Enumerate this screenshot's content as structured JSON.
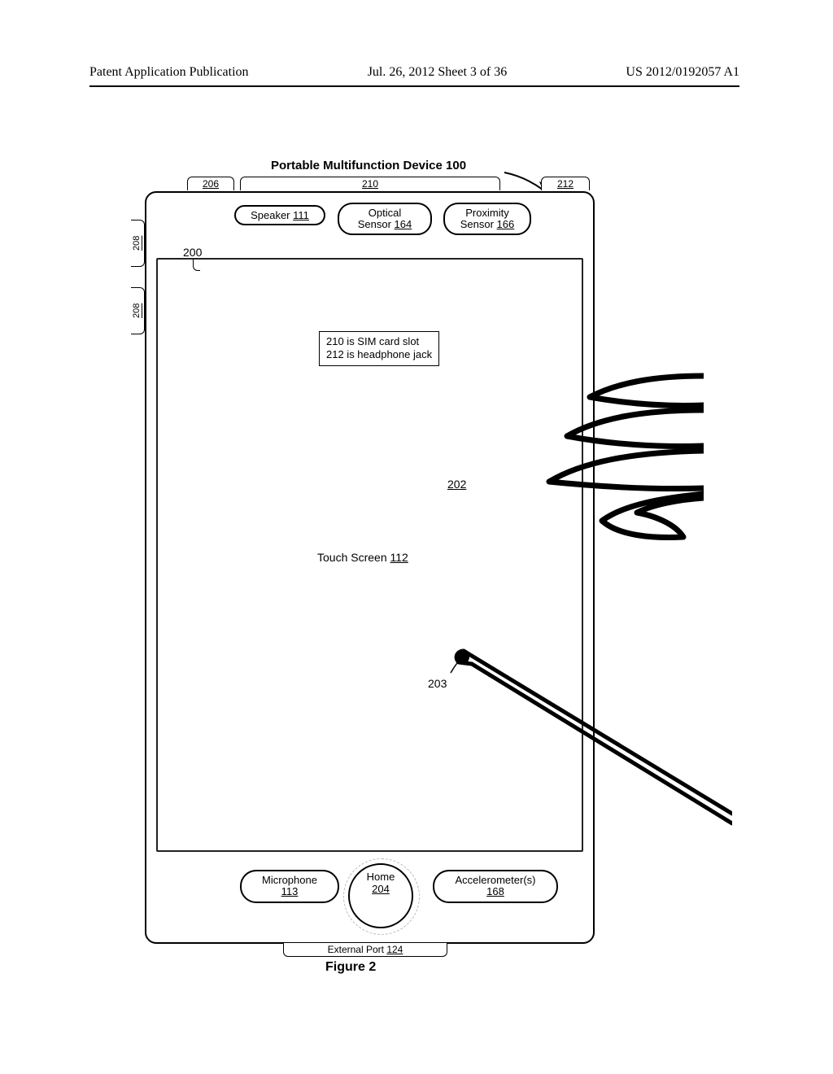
{
  "header": {
    "left": "Patent Application Publication",
    "center": "Jul. 26, 2012  Sheet 3 of 36",
    "right": "US 2012/0192057 A1"
  },
  "title": "Portable Multifunction Device 100",
  "top_tabs": {
    "t206": "206",
    "t210": "210",
    "t212": "212"
  },
  "side_tabs": {
    "s208a": "208",
    "s208b": "208"
  },
  "top_sensors": {
    "speaker": {
      "l1": "Speaker ",
      "ref": "111"
    },
    "optical": {
      "l1": "Optical",
      "l2": "Sensor ",
      "ref": "164"
    },
    "proximity": {
      "l1": "Proximity",
      "l2": "Sensor ",
      "ref": "166"
    }
  },
  "touch_screen": {
    "label": "Touch Screen ",
    "ref": "112"
  },
  "ref_200": "200",
  "ref_202": "202",
  "ref_203": "203",
  "note": {
    "l1": "210 is SIM card slot",
    "l2": "212 is headphone jack"
  },
  "bottom": {
    "mic": {
      "l1": "Microphone",
      "ref": "113"
    },
    "home": {
      "l1": "Home",
      "ref": "204"
    },
    "accel": {
      "l1": "Accelerometer(s)",
      "ref": "168"
    }
  },
  "external_port": {
    "label": "External Port ",
    "ref": "124"
  },
  "caption": "Figure 2"
}
